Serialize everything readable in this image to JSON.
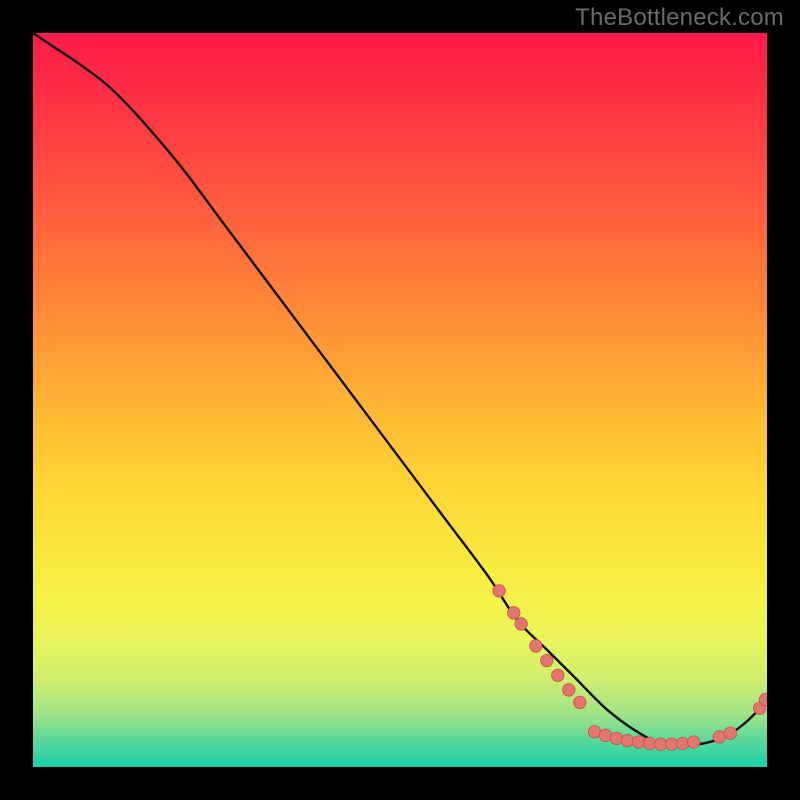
{
  "watermark": "TheBottleneck.com",
  "colors": {
    "frame_bg": "#000000",
    "curve_stroke": "#111111",
    "marker_fill": "#e2766f",
    "marker_stroke": "#c74e48"
  },
  "chart_data": {
    "type": "line",
    "title": "",
    "xlabel": "",
    "ylabel": "",
    "xlim": [
      0,
      100
    ],
    "ylim": [
      0,
      100
    ],
    "grid": false,
    "legend": false,
    "note": "Axes are unlabeled; x and y are percentage of plot area (0–100). y=100 is top.",
    "series": [
      {
        "name": "curve",
        "x": [
          0,
          3,
          6,
          10,
          14,
          20,
          26,
          32,
          38,
          44,
          50,
          56,
          62,
          66,
          70,
          74,
          78,
          82,
          86,
          90,
          94,
          97,
          100
        ],
        "y": [
          100,
          98,
          96,
          93,
          89,
          82,
          74,
          66,
          58,
          50,
          42,
          34,
          26,
          20,
          16,
          12,
          8,
          5,
          3,
          3,
          4,
          6,
          9
        ]
      }
    ],
    "markers": [
      {
        "x": 63.5,
        "y": 24.0
      },
      {
        "x": 65.5,
        "y": 21.0
      },
      {
        "x": 66.5,
        "y": 19.5
      },
      {
        "x": 68.5,
        "y": 16.5
      },
      {
        "x": 70.0,
        "y": 14.5
      },
      {
        "x": 71.5,
        "y": 12.5
      },
      {
        "x": 73.0,
        "y": 10.5
      },
      {
        "x": 74.5,
        "y": 8.8
      },
      {
        "x": 76.5,
        "y": 4.8
      },
      {
        "x": 78.0,
        "y": 4.3
      },
      {
        "x": 79.5,
        "y": 3.9
      },
      {
        "x": 81.0,
        "y": 3.6
      },
      {
        "x": 82.5,
        "y": 3.4
      },
      {
        "x": 84.0,
        "y": 3.2
      },
      {
        "x": 85.5,
        "y": 3.1
      },
      {
        "x": 87.0,
        "y": 3.1
      },
      {
        "x": 88.5,
        "y": 3.2
      },
      {
        "x": 90.0,
        "y": 3.4
      },
      {
        "x": 93.5,
        "y": 4.1
      },
      {
        "x": 95.0,
        "y": 4.6
      },
      {
        "x": 99.0,
        "y": 8.0
      },
      {
        "x": 99.8,
        "y": 9.2
      }
    ]
  }
}
